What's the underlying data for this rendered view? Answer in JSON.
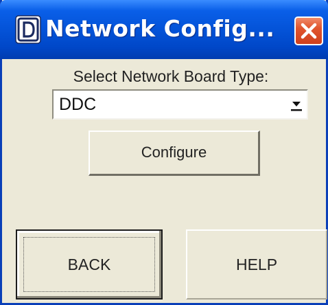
{
  "window": {
    "title": "Network Config...",
    "app_icon": "letter-d-app-icon",
    "close_icon": "close-x-icon"
  },
  "main": {
    "label": "Select Network Board Type:",
    "board_type_select": {
      "selected": "DDC",
      "arrow_icon": "dropdown-arrow-icon"
    },
    "configure_label": "Configure"
  },
  "footer": {
    "back_label": "BACK",
    "help_label": "HELP"
  },
  "colors": {
    "title_bar": "#0453D8",
    "window_bg": "#ECE9D8",
    "close_button": "#E0552E",
    "text": "#222222"
  }
}
